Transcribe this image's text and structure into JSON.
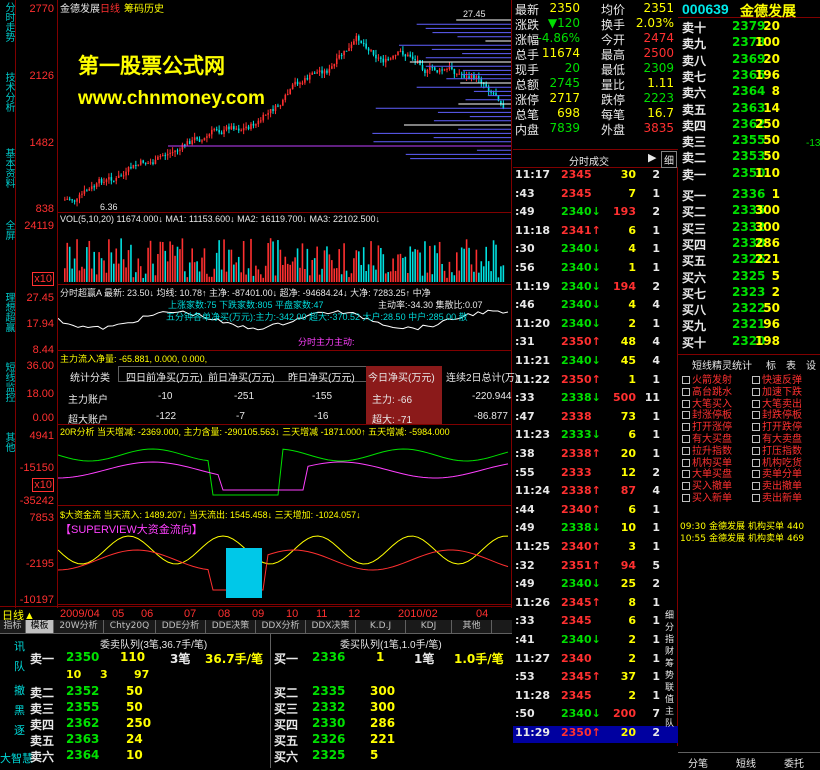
{
  "window": {
    "stock_name": "金德发展",
    "period": "日线",
    "menu_item": "筹码历史"
  },
  "left_tabs": [
    "分时走势",
    "技术分析",
    "基本资料",
    "全屏",
    "理想超赢",
    "短线监控",
    "其他"
  ],
  "price_axis": {
    "p1": "2770",
    "p2": "2126",
    "p3": "1482",
    "p4": "838",
    "vol1": "24119",
    "vol2": "x10",
    "a1": "27.45",
    "a2": "17.94",
    "a3": "8.44",
    "b1": "36.00",
    "b2": "18.00",
    "b3": "0.00",
    "c1": "4941",
    "c2": "-15150",
    "c3": "-35242",
    "c4": "x10",
    "d1": "7853",
    "d2": "-2195",
    "d3": "-10197"
  },
  "watermark": {
    "line1": "第一股票公式网",
    "line2": "www.chnmoney.com"
  },
  "chart_labels": {
    "price_top": "27.45",
    "price_low": "6.36",
    "vol": "VOL(5,10,20) 11674.000↓ MA1: 11153.600↓ MA2: 16119.700↓ MA3: 22102.500↓",
    "cost1": "分时超赢A 最新: 23.50↓ 均线: 10.78↑ 主净: -87401.00↓ 超净: -94684.24↓ 大净: 7283.25↑ 中净",
    "cost2": "上涨家数:75 下跌家数:805 平盘家数:47",
    "cost3": "主动率:-34.30 集散比:0.07",
    "cost4": "五分钟各单净买(万元):主力:-342.00 超大:-370.52 大户:28.50 中户:285.00 散",
    "flow1": "分时主力主动:",
    "net_in": "主力流入净量: -65.881, 0.000, 0.000,",
    "ddx": "20R分析 当天增减: -2369.000, 主力含量: -290105.563↓ 三天增减 -1871.000↑ 五天增减: -5984.000",
    "big": "$大资金流 当天流入: 1489.207↓ 当天流出: 1545.458↓ 三天增加: -1024.057↓",
    "super": "【SUPERVIEW大资金流向】",
    "dates": [
      "2009/04",
      "05",
      "06",
      "07",
      "08",
      "09",
      "10",
      "11",
      "12",
      "2010/02",
      "04"
    ],
    "timeframe": "日线▲"
  },
  "table": {
    "headers": [
      "统计分类",
      "四日前净买(万元)",
      "前日净买(万元)",
      "昨日净买(万元)",
      "今日净买(万元)",
      "连续2日总计(万)"
    ],
    "rows": [
      [
        "主力账户",
        "-10",
        "-251",
        "-155",
        "主力: -66",
        "-220.944"
      ],
      [
        "超大账户",
        "-122",
        "-7",
        "-16",
        "超大: -71",
        "-86.877"
      ]
    ]
  },
  "quote": [
    [
      "最新",
      "2350",
      "均价",
      "2351"
    ],
    [
      "涨跌",
      "▼120",
      "换手",
      "2.03%"
    ],
    [
      "涨幅",
      "-4.86%",
      "今开",
      "2474"
    ],
    [
      "总手",
      "11674",
      "最高",
      "2500"
    ],
    [
      "现手",
      "20",
      "最低",
      "2309"
    ],
    [
      "总额",
      "2745",
      "量比",
      "1.11"
    ],
    [
      "涨停",
      "2717",
      "跌停",
      "2223"
    ],
    [
      "总笔",
      "698",
      "每笔",
      "16.7"
    ],
    [
      "内盘",
      "7839",
      "外盘",
      "3835"
    ]
  ],
  "ticks_header": {
    "label": "分时成交",
    "btn": "细"
  },
  "ticks": [
    [
      "11:17",
      "2345",
      "30",
      "2"
    ],
    [
      ":43",
      "2345",
      "7",
      "1"
    ],
    [
      ":49",
      "2340↓",
      "193",
      "2"
    ],
    [
      "11:18",
      "2341↑",
      "6",
      "1"
    ],
    [
      ":30",
      "2340↓",
      "4",
      "1"
    ],
    [
      ":56",
      "2340↓",
      "1",
      "1"
    ],
    [
      "11:19",
      "2340↓",
      "194",
      "2"
    ],
    [
      ":46",
      "2340↓",
      "4",
      "4"
    ],
    [
      "11:20",
      "2340↓",
      "2",
      "1"
    ],
    [
      ":31",
      "2350↑",
      "48",
      "4"
    ],
    [
      "11:21",
      "2340↓",
      "45",
      "4"
    ],
    [
      "11:22",
      "2350↑",
      "1",
      "1"
    ],
    [
      ":33",
      "2338↓",
      "500",
      "11"
    ],
    [
      ":47",
      "2338",
      "73",
      "1"
    ],
    [
      "11:23",
      "2333↓",
      "6",
      "1"
    ],
    [
      ":38",
      "2338↑",
      "20",
      "1"
    ],
    [
      ":55",
      "2333",
      "12",
      "2"
    ],
    [
      "11:24",
      "2338↑",
      "87",
      "4"
    ],
    [
      ":44",
      "2340↑",
      "6",
      "1"
    ],
    [
      ":49",
      "2338↓",
      "10",
      "1"
    ],
    [
      "11:25",
      "2340↑",
      "3",
      "1"
    ],
    [
      ":32",
      "2351↑",
      "94",
      "5"
    ],
    [
      ":49",
      "2340↓",
      "25",
      "2"
    ],
    [
      "11:26",
      "2345↑",
      "8",
      "1"
    ],
    [
      ":33",
      "2345",
      "6",
      "1"
    ],
    [
      ":41",
      "2340↓",
      "2",
      "1"
    ],
    [
      "11:27",
      "2340",
      "2",
      "1"
    ],
    [
      ":53",
      "2345↑",
      "37",
      "1"
    ],
    [
      "11:28",
      "2345",
      "2",
      "1"
    ],
    [
      ":50",
      "2340↓",
      "200",
      "7"
    ],
    [
      "11:29",
      "2350↑",
      "20",
      "2"
    ]
  ],
  "depth": {
    "code": "000639",
    "name": "金德发展",
    "asks": [
      [
        "卖十",
        "2379",
        "20"
      ],
      [
        "卖九",
        "2378",
        "100"
      ],
      [
        "卖八",
        "2369",
        "20"
      ],
      [
        "卖七",
        "2365",
        "196"
      ],
      [
        "卖六",
        "2364",
        "8"
      ],
      [
        "卖五",
        "2363",
        "14"
      ],
      [
        "卖四",
        "2362",
        "250"
      ],
      [
        "卖三",
        "2355",
        "50"
      ],
      [
        "卖二",
        "2353",
        "50"
      ],
      [
        "卖一",
        "2350",
        "110"
      ]
    ],
    "bids": [
      [
        "买一",
        "2336",
        "1"
      ],
      [
        "买二",
        "2335",
        "300"
      ],
      [
        "买三",
        "2332",
        "300"
      ],
      [
        "买四",
        "2330",
        "286"
      ],
      [
        "买五",
        "2326",
        "221"
      ],
      [
        "买六",
        "2325",
        "5"
      ],
      [
        "买七",
        "2323",
        "2"
      ],
      [
        "买八",
        "2322",
        "50"
      ],
      [
        "买九",
        "2321",
        "96"
      ],
      [
        "买十",
        "2320",
        "198"
      ]
    ],
    "ask_change": "-13"
  },
  "strategy": {
    "tabs": [
      "短线精灵统计",
      "标",
      "表",
      "设"
    ],
    "items": [
      "火箭发射",
      "快速反弹",
      "高台跳水",
      "加速下跌",
      "大笔买入",
      "大笔卖出",
      "封涨停板",
      "封跌停板",
      "打开涨停",
      "打开跌停",
      "有大买盘",
      "有大卖盘",
      "拉升指数",
      "打压指数",
      "机构买单",
      "机构吃货",
      "大单买盘",
      "卖单分单",
      "买入撤单",
      "卖出撤单",
      "买入新单",
      "卖出新单"
    ],
    "log": [
      [
        "09:30",
        "金德发展",
        "机构买单",
        "440"
      ],
      [
        "10:55",
        "金德发展",
        "机构卖单",
        "469"
      ]
    ]
  },
  "bottom_tabs": [
    "指标",
    "模板",
    "20W分析",
    "Chty20Q",
    "DDE分析",
    "DDE决策",
    "DDX分析",
    "DDX决策",
    "K.D.J",
    "KDJ",
    "其他"
  ],
  "queue": {
    "ask_title": "委卖队列(3笔,36.7手/笔)",
    "bid_title": "委买队列(1笔,1.0手/笔)",
    "ask1": [
      "卖一",
      "2350",
      "110",
      "3笔",
      "36.7手/笔"
    ],
    "ask1_detail": [
      "10",
      "3",
      "97"
    ],
    "bid1": [
      "买一",
      "2336",
      "1",
      "1笔",
      "1.0手/笔"
    ],
    "asks": [
      [
        "卖二",
        "2352",
        "50"
      ],
      [
        "卖三",
        "2355",
        "50"
      ],
      [
        "卖四",
        "2362",
        "250"
      ],
      [
        "卖五",
        "2363",
        "24"
      ],
      [
        "卖六",
        "2364",
        "10"
      ]
    ],
    "bids": [
      [
        "买二",
        "2335",
        "300"
      ],
      [
        "买三",
        "2332",
        "300"
      ],
      [
        "买四",
        "2330",
        "286"
      ],
      [
        "买五",
        "2326",
        "221"
      ],
      [
        "买六",
        "2325",
        "5"
      ]
    ],
    "side_labels": [
      "讯",
      "队",
      "撤",
      "黑",
      "逐",
      "大智慧"
    ]
  },
  "right_tabs": [
    "细",
    "分",
    "指",
    "财",
    "筹",
    "势",
    "联",
    "值",
    "主",
    "队"
  ],
  "bottom_right_tabs": [
    "分笔",
    "短线",
    "委托"
  ],
  "colors": {
    "up": "#ff3030",
    "down": "#00e000",
    "bg": "#000000",
    "border": "#800000",
    "accent": "#ffff00"
  }
}
